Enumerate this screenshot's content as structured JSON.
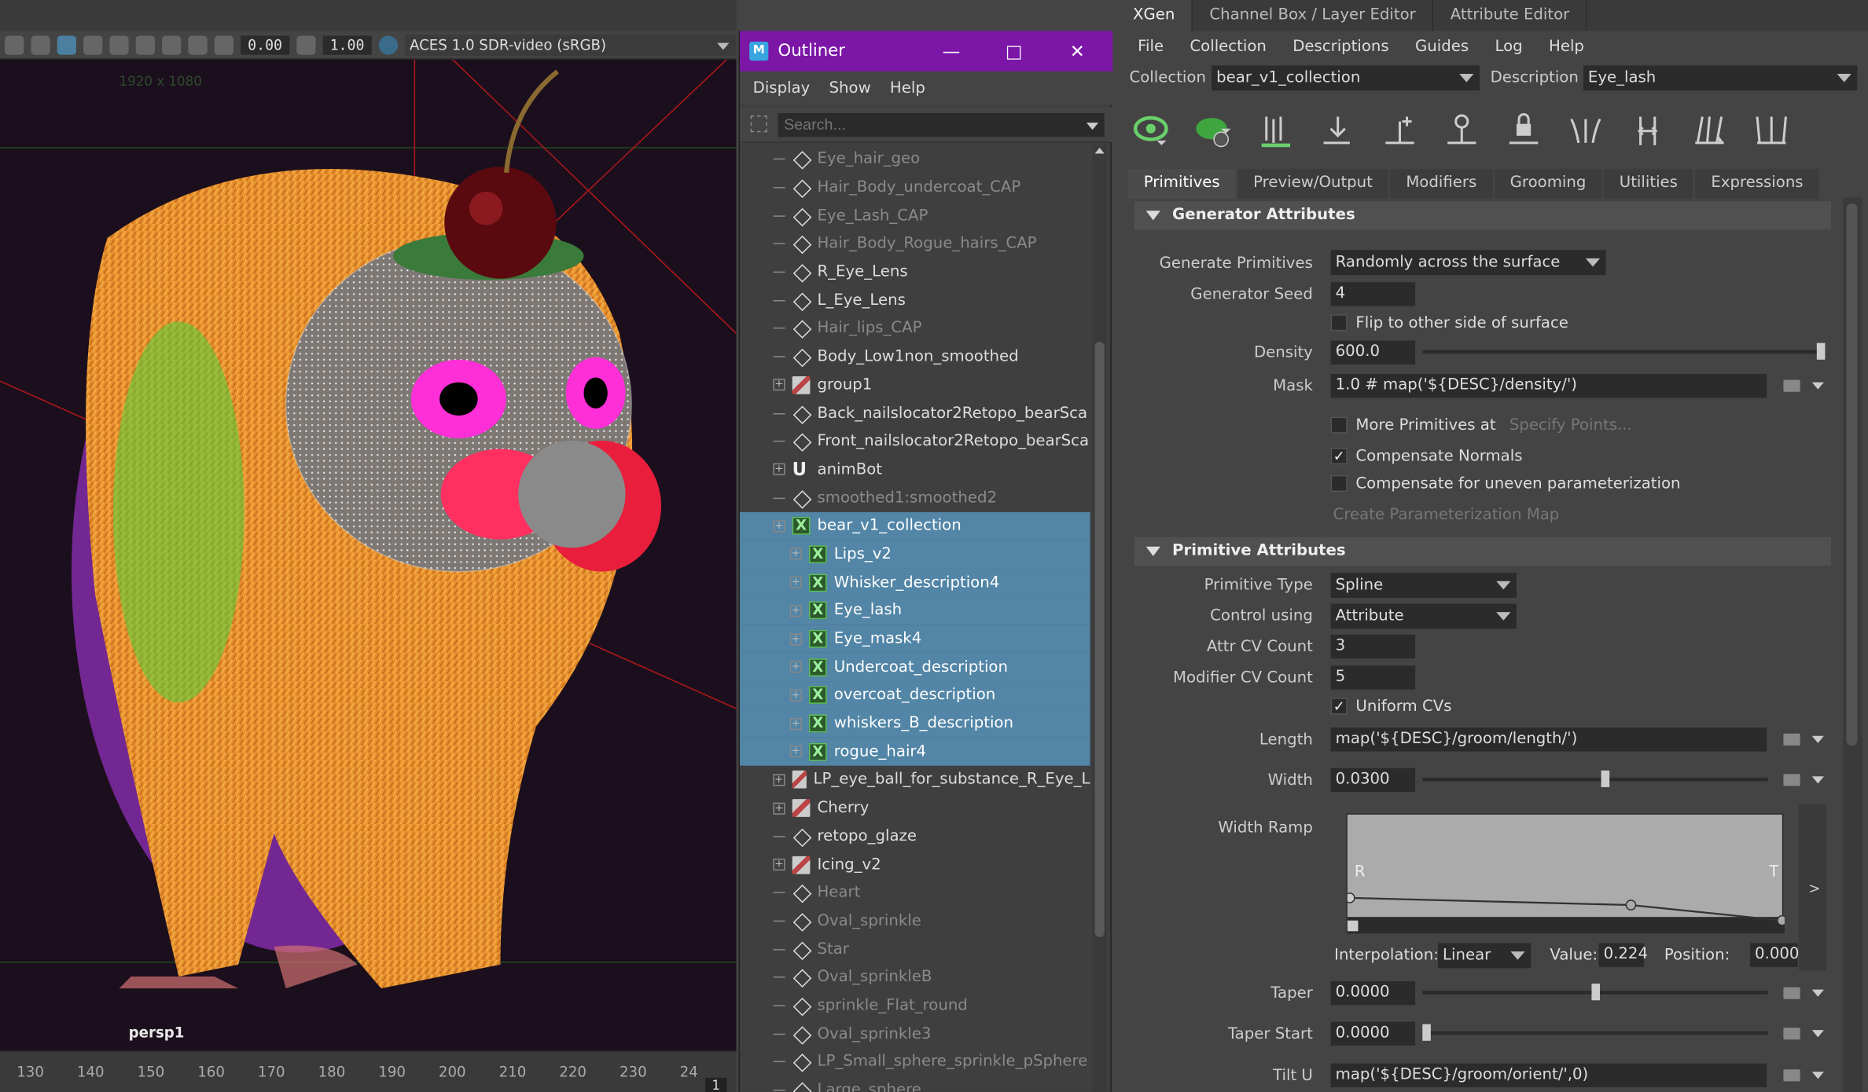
{
  "viewport": {
    "toolbar": {
      "value1": "0.00",
      "value2": "1.00",
      "colorspace": "ACES 1.0 SDR-video (sRGB)"
    },
    "resolution_gate": "1920 x 1080",
    "camera": "persp1",
    "timeline_ticks": [
      "130",
      "140",
      "150",
      "160",
      "170",
      "180",
      "190",
      "200",
      "210",
      "220",
      "230",
      "24"
    ],
    "current_frame": "1"
  },
  "outliner": {
    "title": "Outliner",
    "menu": [
      "Display",
      "Show",
      "Help"
    ],
    "search_placeholder": "Search...",
    "rows": [
      {
        "label": "Eye_hair_geo",
        "icon": "transform",
        "dim": true,
        "expand": false
      },
      {
        "label": "Hair_Body_undercoat_CAP",
        "icon": "transform",
        "dim": true,
        "expand": false
      },
      {
        "label": "Eye_Lash_CAP",
        "icon": "transform",
        "dim": true,
        "expand": false
      },
      {
        "label": "Hair_Body_Rogue_hairs_CAP",
        "icon": "transform",
        "dim": true,
        "expand": false
      },
      {
        "label": "R_Eye_Lens",
        "icon": "transform",
        "dim": false,
        "expand": false
      },
      {
        "label": "L_Eye_Lens",
        "icon": "transform",
        "dim": false,
        "expand": false
      },
      {
        "label": "Hair_lips_CAP",
        "icon": "transform",
        "dim": true,
        "expand": false
      },
      {
        "label": "Body_Low1non_smoothed",
        "icon": "transform",
        "dim": false,
        "expand": false
      },
      {
        "label": "group1",
        "icon": "group",
        "dim": false,
        "expand": true
      },
      {
        "label": "Back_nailslocator2Retopo_bearSca",
        "icon": "transform",
        "dim": false,
        "expand": false
      },
      {
        "label": "Front_nailslocator2Retopo_bearSca",
        "icon": "transform",
        "dim": false,
        "expand": false
      },
      {
        "label": "animBot",
        "icon": "magnet",
        "dim": false,
        "expand": true
      },
      {
        "label": "smoothed1:smoothed2",
        "icon": "transform",
        "dim": true,
        "expand": false
      },
      {
        "label": "bear_v1_collection",
        "icon": "xgen",
        "dim": false,
        "expand": true,
        "sel": true,
        "indent": 0
      },
      {
        "label": "Lips_v2",
        "icon": "xgen",
        "dim": false,
        "expand": true,
        "sel": true,
        "indent": 1
      },
      {
        "label": "Whisker_description4",
        "icon": "xgen",
        "dim": false,
        "expand": true,
        "sel": true,
        "indent": 1
      },
      {
        "label": "Eye_lash",
        "icon": "xgen",
        "dim": false,
        "expand": true,
        "sel": true,
        "indent": 1
      },
      {
        "label": "Eye_mask4",
        "icon": "xgen",
        "dim": false,
        "expand": true,
        "sel": true,
        "indent": 1
      },
      {
        "label": "Undercoat_description",
        "icon": "xgen",
        "dim": false,
        "expand": true,
        "sel": true,
        "indent": 1
      },
      {
        "label": "overcoat_description",
        "icon": "xgen",
        "dim": false,
        "expand": true,
        "sel": true,
        "indent": 1
      },
      {
        "label": "whiskers_B_description",
        "icon": "xgen",
        "dim": false,
        "expand": true,
        "sel": true,
        "indent": 1
      },
      {
        "label": "rogue_hair4",
        "icon": "xgen",
        "dim": false,
        "expand": true,
        "sel": true,
        "indent": 1
      },
      {
        "label": "LP_eye_ball_for_substance_R_Eye_L",
        "icon": "group",
        "dim": false,
        "expand": true
      },
      {
        "label": "Cherry",
        "icon": "group",
        "dim": false,
        "expand": true
      },
      {
        "label": "retopo_glaze",
        "icon": "transform",
        "dim": false,
        "expand": false
      },
      {
        "label": "Icing_v2",
        "icon": "group",
        "dim": false,
        "expand": true
      },
      {
        "label": "Heart",
        "icon": "transform",
        "dim": true,
        "expand": false
      },
      {
        "label": "Oval_sprinkle",
        "icon": "transform",
        "dim": true,
        "expand": false
      },
      {
        "label": "Star",
        "icon": "transform",
        "dim": true,
        "expand": false
      },
      {
        "label": "Oval_sprinkleB",
        "icon": "transform",
        "dim": true,
        "expand": false
      },
      {
        "label": "sprinkle_Flat_round",
        "icon": "transform",
        "dim": true,
        "expand": false
      },
      {
        "label": "Oval_sprinkle3",
        "icon": "transform",
        "dim": true,
        "expand": false
      },
      {
        "label": "LP_Small_sphere_sprinkle_pSphere",
        "icon": "transform",
        "dim": true,
        "expand": false
      },
      {
        "label": "Large_sphere",
        "icon": "transform",
        "dim": true,
        "expand": false
      }
    ]
  },
  "xgen": {
    "tabs": [
      "XGen",
      "Channel Box / Layer Editor",
      "Attribute Editor"
    ],
    "menu": [
      "File",
      "Collection",
      "Descriptions",
      "Guides",
      "Log",
      "Help"
    ],
    "collection_label": "Collection",
    "collection_value": "bear_v1_collection",
    "description_label": "Description",
    "description_value": "Eye_lash",
    "subtabs": [
      "Primitives",
      "Preview/Output",
      "Modifiers",
      "Grooming",
      "Utilities",
      "Expressions"
    ],
    "generator": {
      "title": "Generator Attributes",
      "generate_primitives_label": "Generate Primitives",
      "generate_primitives_value": "Randomly across the surface",
      "seed_label": "Generator Seed",
      "seed_value": "4",
      "flip_label": "Flip to other side of surface",
      "density_label": "Density",
      "density_value": "600.0",
      "density_slider": 1.0,
      "mask_label": "Mask",
      "mask_value": "1.0 # map('${DESC}/density/')",
      "more_prims_label": "More Primitives at",
      "specify_points_label": "Specify Points...",
      "comp_normals_label": "Compensate Normals",
      "comp_uneven_label": "Compensate for uneven parameterization",
      "create_param_map_label": "Create Parameterization Map"
    },
    "primitive": {
      "title": "Primitive Attributes",
      "type_label": "Primitive Type",
      "type_value": "Spline",
      "control_label": "Control using",
      "control_value": "Attribute",
      "attr_cv_label": "Attr CV Count",
      "attr_cv_value": "3",
      "mod_cv_label": "Modifier CV Count",
      "mod_cv_value": "5",
      "uniform_label": "Uniform CVs",
      "length_label": "Length",
      "length_value": "map('${DESC}/groom/length/')",
      "width_label": "Width",
      "width_value": "0.0300",
      "width_slider": 0.53,
      "width_ramp_label": "Width Ramp",
      "ramp_left": "R",
      "ramp_right": "T",
      "interp_label": "Interpolation:",
      "interp_value": "Linear",
      "value_label": "Value:",
      "value_value": "0.224",
      "position_label": "Position:",
      "position_value": "0.000",
      "taper_label": "Taper",
      "taper_value": "0.0000",
      "taper_slider": 0.5,
      "taper_start_label": "Taper Start",
      "taper_start_value": "0.0000",
      "taper_start_slider": 0.0,
      "tilt_label": "Tilt U",
      "tilt_value": "map('${DESC}/groom/orient/',0)"
    }
  }
}
